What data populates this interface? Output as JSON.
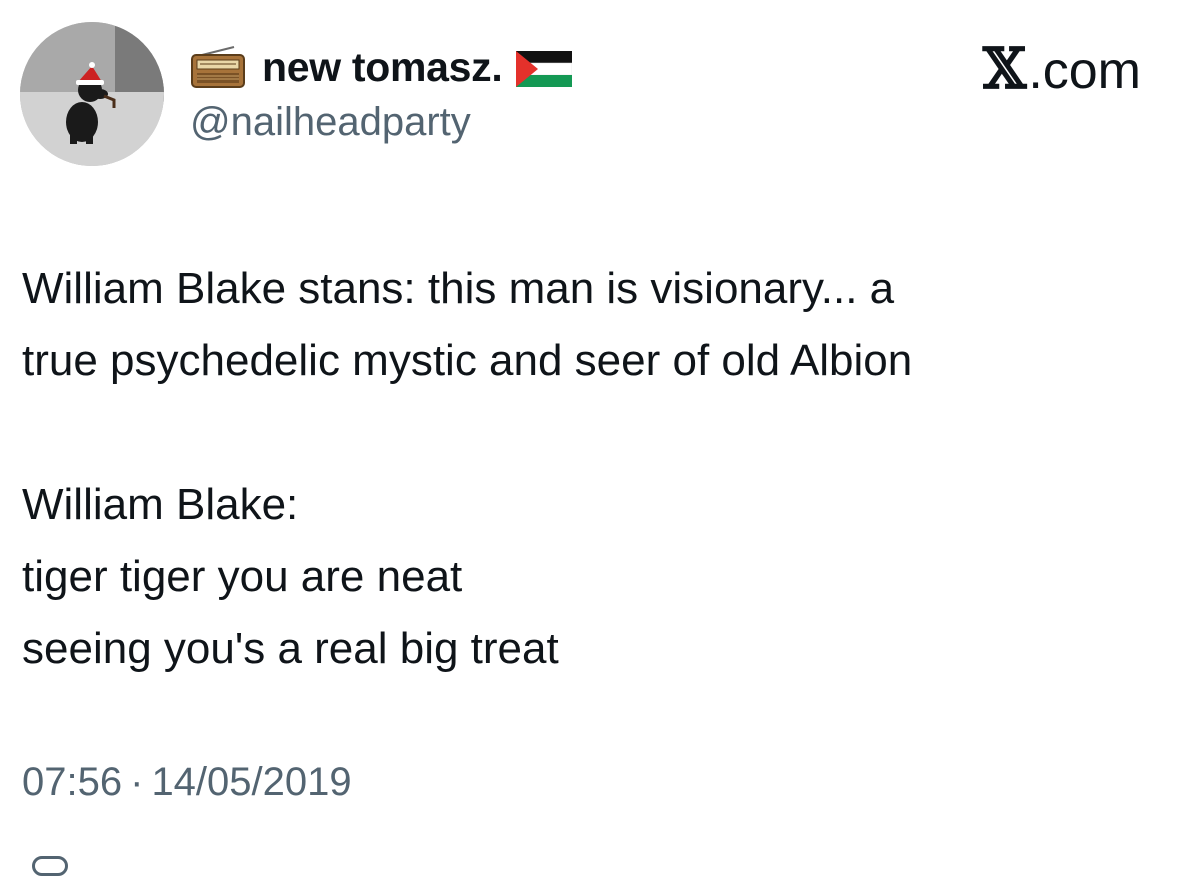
{
  "header": {
    "display_name": "new tomasz.",
    "handle": "@nailheadparty",
    "brand_x": "𝕏",
    "brand_domain": ".com",
    "avatar_icon": "avatar-dog-with-santa-hat",
    "name_prefix_icon": "radio-emoji-icon",
    "name_suffix_icon": "palestine-flag-icon"
  },
  "tweet": {
    "lines": [
      "William Blake stans: this man is visionary... a",
      "true psychedelic mystic and seer of old Albion",
      "",
      "William Blake:",
      "tiger tiger you are neat",
      "seeing you's a real big treat"
    ]
  },
  "meta": {
    "time": "07:56",
    "separator": "·",
    "date": "14/05/2019"
  },
  "colors": {
    "text": "#0f1419",
    "secondary": "#536471",
    "background": "#ffffff"
  }
}
